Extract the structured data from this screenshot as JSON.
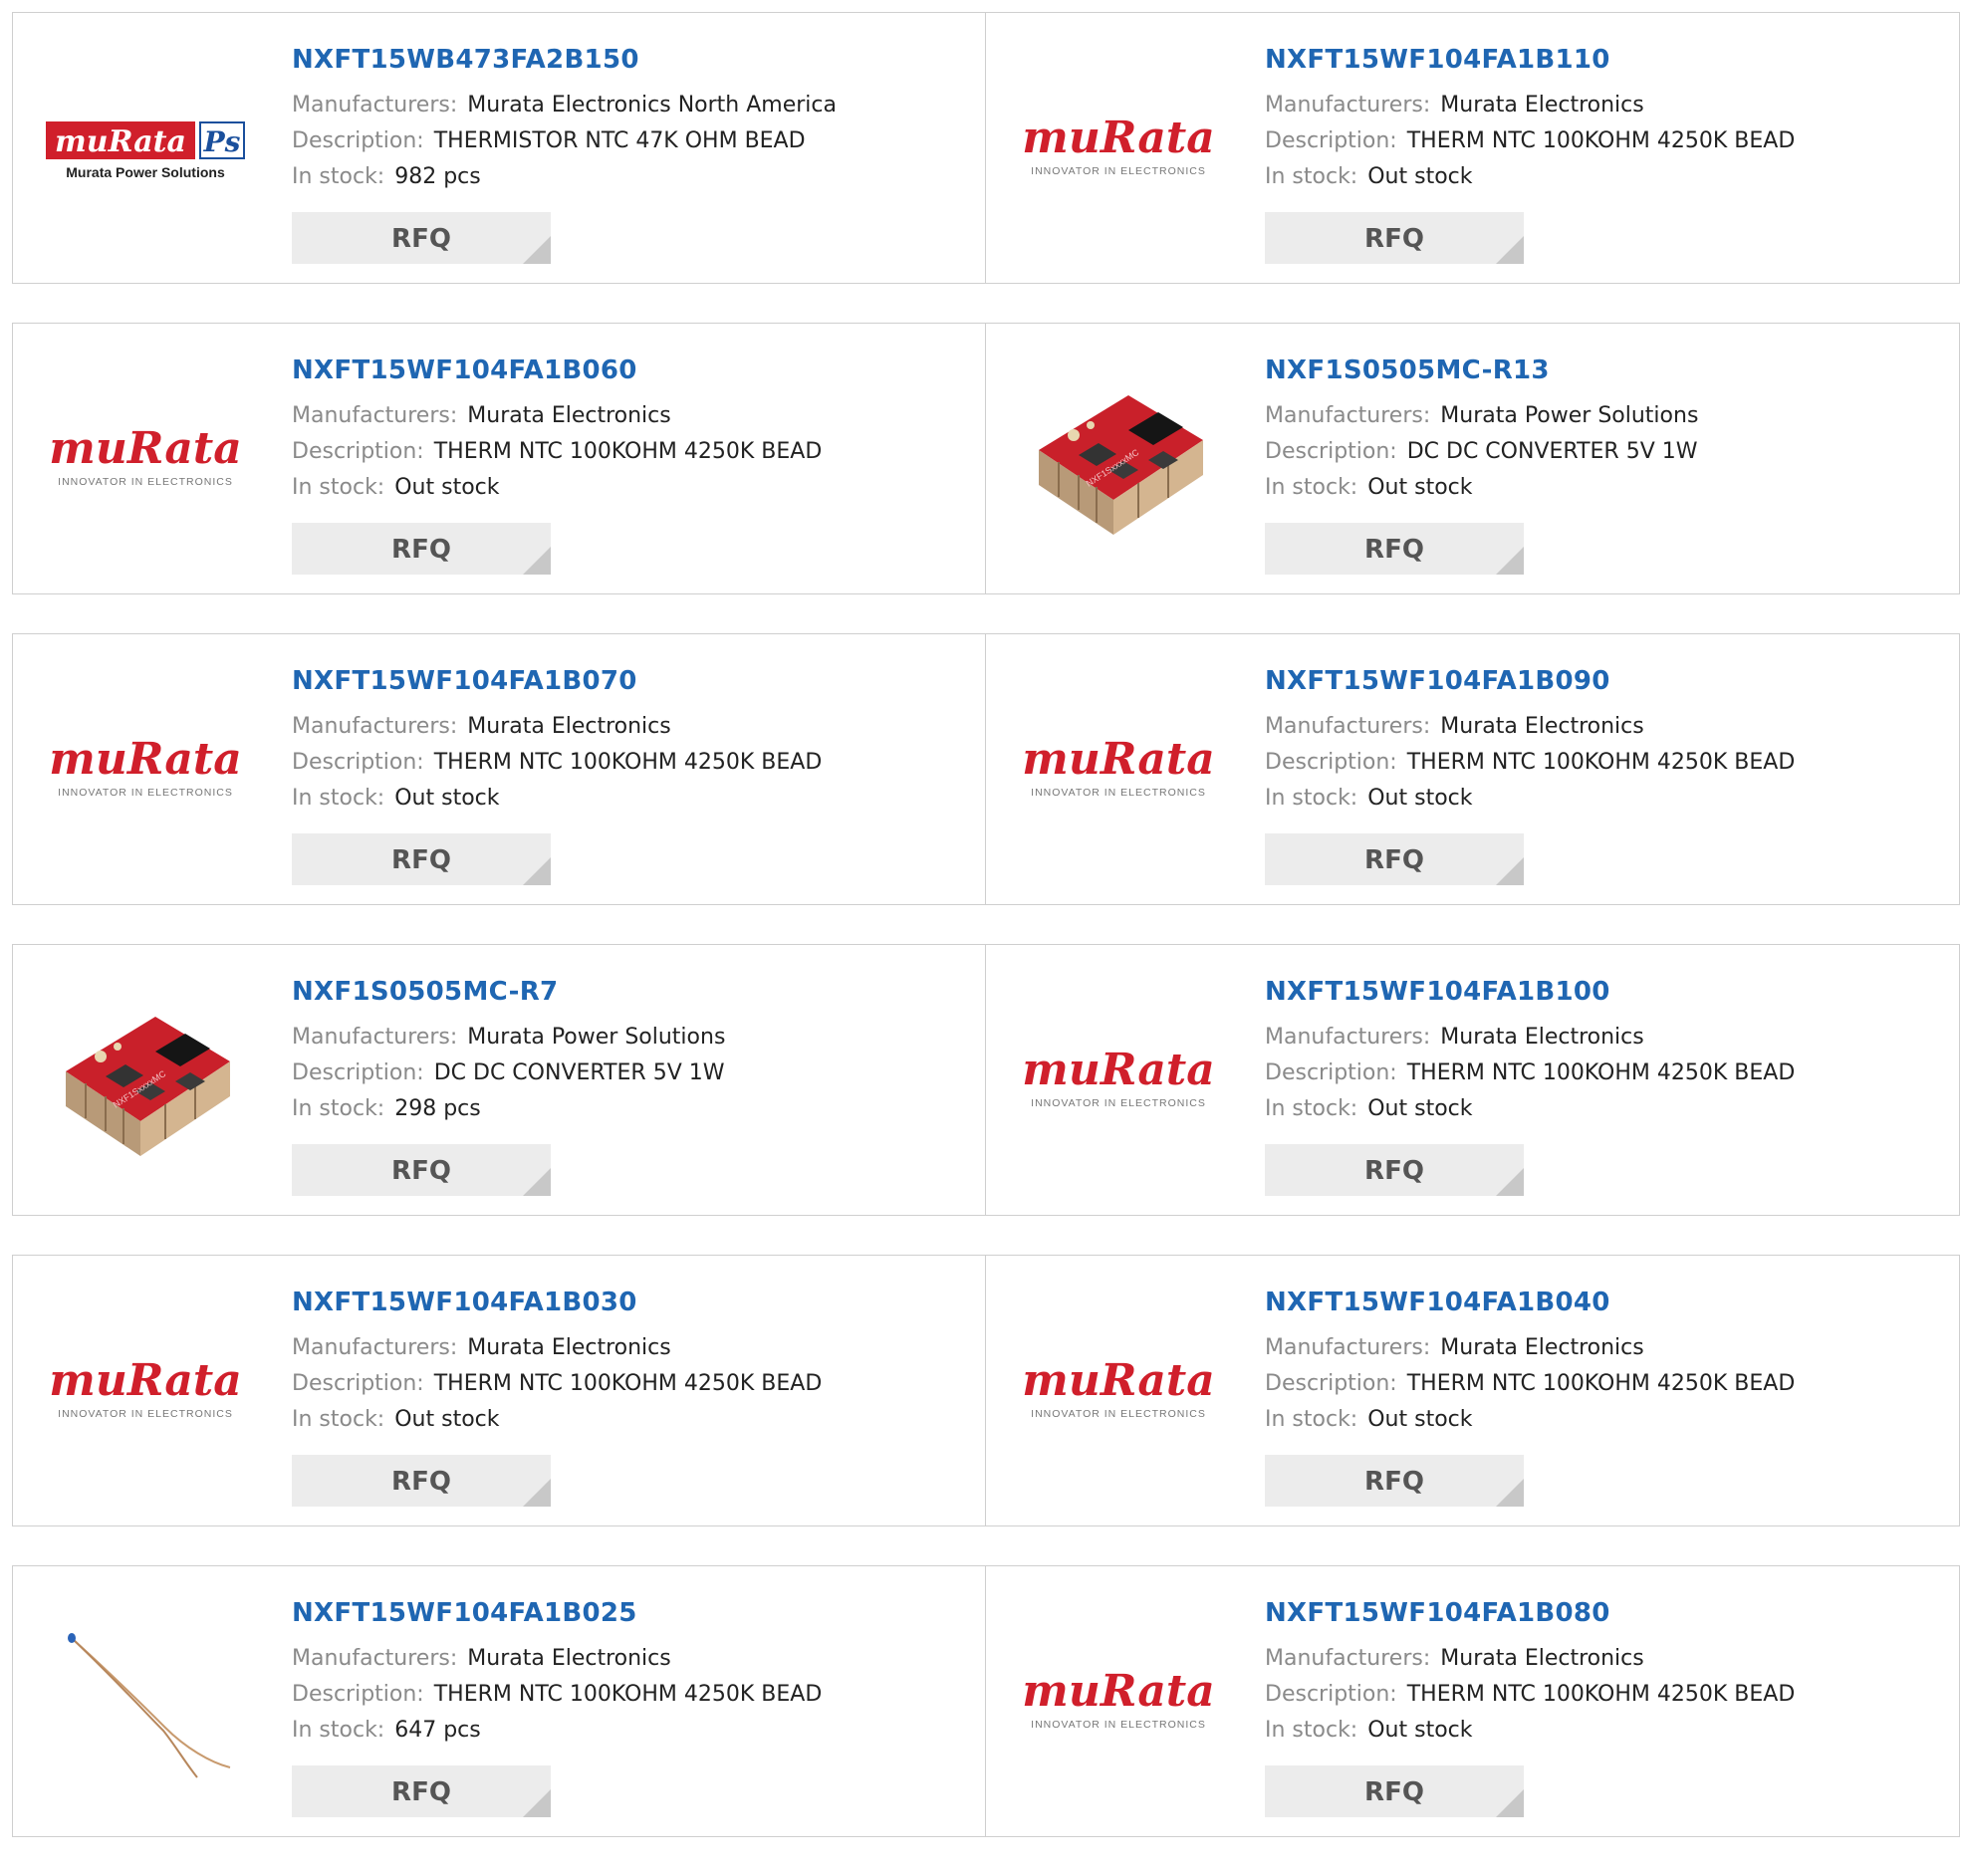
{
  "labels": {
    "manufacturers": "Manufacturers:",
    "description": "Description:",
    "in_stock": "In stock:",
    "rfq": "RFQ"
  },
  "logos": {
    "murata": "muRata",
    "murata_tagline": "INNOVATOR IN ELECTRONICS",
    "ps_badge": "Ps",
    "ps_tagline": "Murata Power Solutions",
    "module_marking": "NXF1SxxxxMC"
  },
  "colors": {
    "link": "#1f66b2",
    "murata_red": "#d01f2b",
    "border": "#cfcfcf",
    "button_bg": "#ececec"
  },
  "rows": [
    [
      {
        "part": "NXFT15WB473FA2B150",
        "manufacturer": "Murata Electronics North America",
        "description": "THERMISTOR NTC 47K OHM BEAD",
        "stock": "982 pcs",
        "image": "murata-power-solutions-logo"
      },
      {
        "part": "NXFT15WF104FA1B110",
        "manufacturer": "Murata Electronics",
        "description": "THERM NTC 100KOHM 4250K BEAD",
        "stock": "Out stock",
        "image": "murata-logo"
      }
    ],
    [
      {
        "part": "NXFT15WF104FA1B060",
        "manufacturer": "Murata Electronics",
        "description": "THERM NTC 100KOHM 4250K BEAD",
        "stock": "Out stock",
        "image": "murata-logo"
      },
      {
        "part": "NXF1S0505MC-R13",
        "manufacturer": "Murata Power Solutions",
        "description": "DC DC CONVERTER 5V 1W",
        "stock": "Out stock",
        "image": "dc-converter-module"
      }
    ],
    [
      {
        "part": "NXFT15WF104FA1B070",
        "manufacturer": "Murata Electronics",
        "description": "THERM NTC 100KOHM 4250K BEAD",
        "stock": "Out stock",
        "image": "murata-logo"
      },
      {
        "part": "NXFT15WF104FA1B090",
        "manufacturer": "Murata Electronics",
        "description": "THERM NTC 100KOHM 4250K BEAD",
        "stock": "Out stock",
        "image": "murata-logo"
      }
    ],
    [
      {
        "part": "NXF1S0505MC-R7",
        "manufacturer": "Murata Power Solutions",
        "description": "DC DC CONVERTER 5V 1W",
        "stock": "298 pcs",
        "image": "dc-converter-module"
      },
      {
        "part": "NXFT15WF104FA1B100",
        "manufacturer": "Murata Electronics",
        "description": "THERM NTC 100KOHM 4250K BEAD",
        "stock": "Out stock",
        "image": "murata-logo"
      }
    ],
    [
      {
        "part": "NXFT15WF104FA1B030",
        "manufacturer": "Murata Electronics",
        "description": "THERM NTC 100KOHM 4250K BEAD",
        "stock": "Out stock",
        "image": "murata-logo"
      },
      {
        "part": "NXFT15WF104FA1B040",
        "manufacturer": "Murata Electronics",
        "description": "THERM NTC 100KOHM 4250K BEAD",
        "stock": "Out stock",
        "image": "murata-logo"
      }
    ],
    [
      {
        "part": "NXFT15WF104FA1B025",
        "manufacturer": "Murata Electronics",
        "description": "THERM NTC 100KOHM 4250K BEAD",
        "stock": "647 pcs",
        "image": "thermistor-wire"
      },
      {
        "part": "NXFT15WF104FA1B080",
        "manufacturer": "Murata Electronics",
        "description": "THERM NTC 100KOHM 4250K BEAD",
        "stock": "Out stock",
        "image": "murata-logo"
      }
    ]
  ]
}
